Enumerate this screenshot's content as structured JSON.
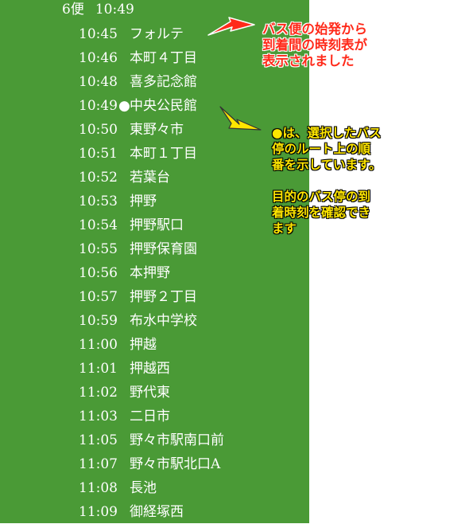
{
  "header": {
    "bin": "6便",
    "time": "10:49"
  },
  "rows": [
    {
      "time": "10:45",
      "marker": "",
      "stop": "フォルテ"
    },
    {
      "time": "10:46",
      "marker": "",
      "stop": "本町４丁目"
    },
    {
      "time": "10:48",
      "marker": "",
      "stop": "喜多記念館"
    },
    {
      "time": "10:49",
      "marker": "●",
      "stop": "中央公民館"
    },
    {
      "time": "10:50",
      "marker": "",
      "stop": "東野々市"
    },
    {
      "time": "10:51",
      "marker": "",
      "stop": "本町１丁目"
    },
    {
      "time": "10:52",
      "marker": "",
      "stop": "若葉台"
    },
    {
      "time": "10:53",
      "marker": "",
      "stop": "押野"
    },
    {
      "time": "10:54",
      "marker": "",
      "stop": "押野駅口"
    },
    {
      "time": "10:55",
      "marker": "",
      "stop": "押野保育園"
    },
    {
      "time": "10:56",
      "marker": "",
      "stop": "本押野"
    },
    {
      "time": "10:57",
      "marker": "",
      "stop": "押野２丁目"
    },
    {
      "time": "10:59",
      "marker": "",
      "stop": "布水中学校"
    },
    {
      "time": "11:00",
      "marker": "",
      "stop": "押越"
    },
    {
      "time": "11:01",
      "marker": "",
      "stop": "押越西"
    },
    {
      "time": "11:02",
      "marker": "",
      "stop": "野代東"
    },
    {
      "time": "11:03",
      "marker": "",
      "stop": "二日市"
    },
    {
      "time": "11:05",
      "marker": "",
      "stop": "野々市駅南口前"
    },
    {
      "time": "11:07",
      "marker": "",
      "stop": "野々市駅北口A"
    },
    {
      "time": "11:08",
      "marker": "",
      "stop": "長池"
    },
    {
      "time": "11:09",
      "marker": "",
      "stop": "御経塚西"
    }
  ],
  "annotations": {
    "red_note": [
      "バス便の始発から",
      "到着間の時刻表が",
      "表示されました"
    ],
    "yellow_note": [
      "●は、選択したバス",
      "停のルート上の順",
      "番を示しています。",
      "",
      "目的のバス停の到",
      "着時刻を確認でき",
      "ます"
    ],
    "red_color": "#ff2a1a",
    "yellow_color": "#ffe600",
    "panel_color": "#4a9a36"
  }
}
